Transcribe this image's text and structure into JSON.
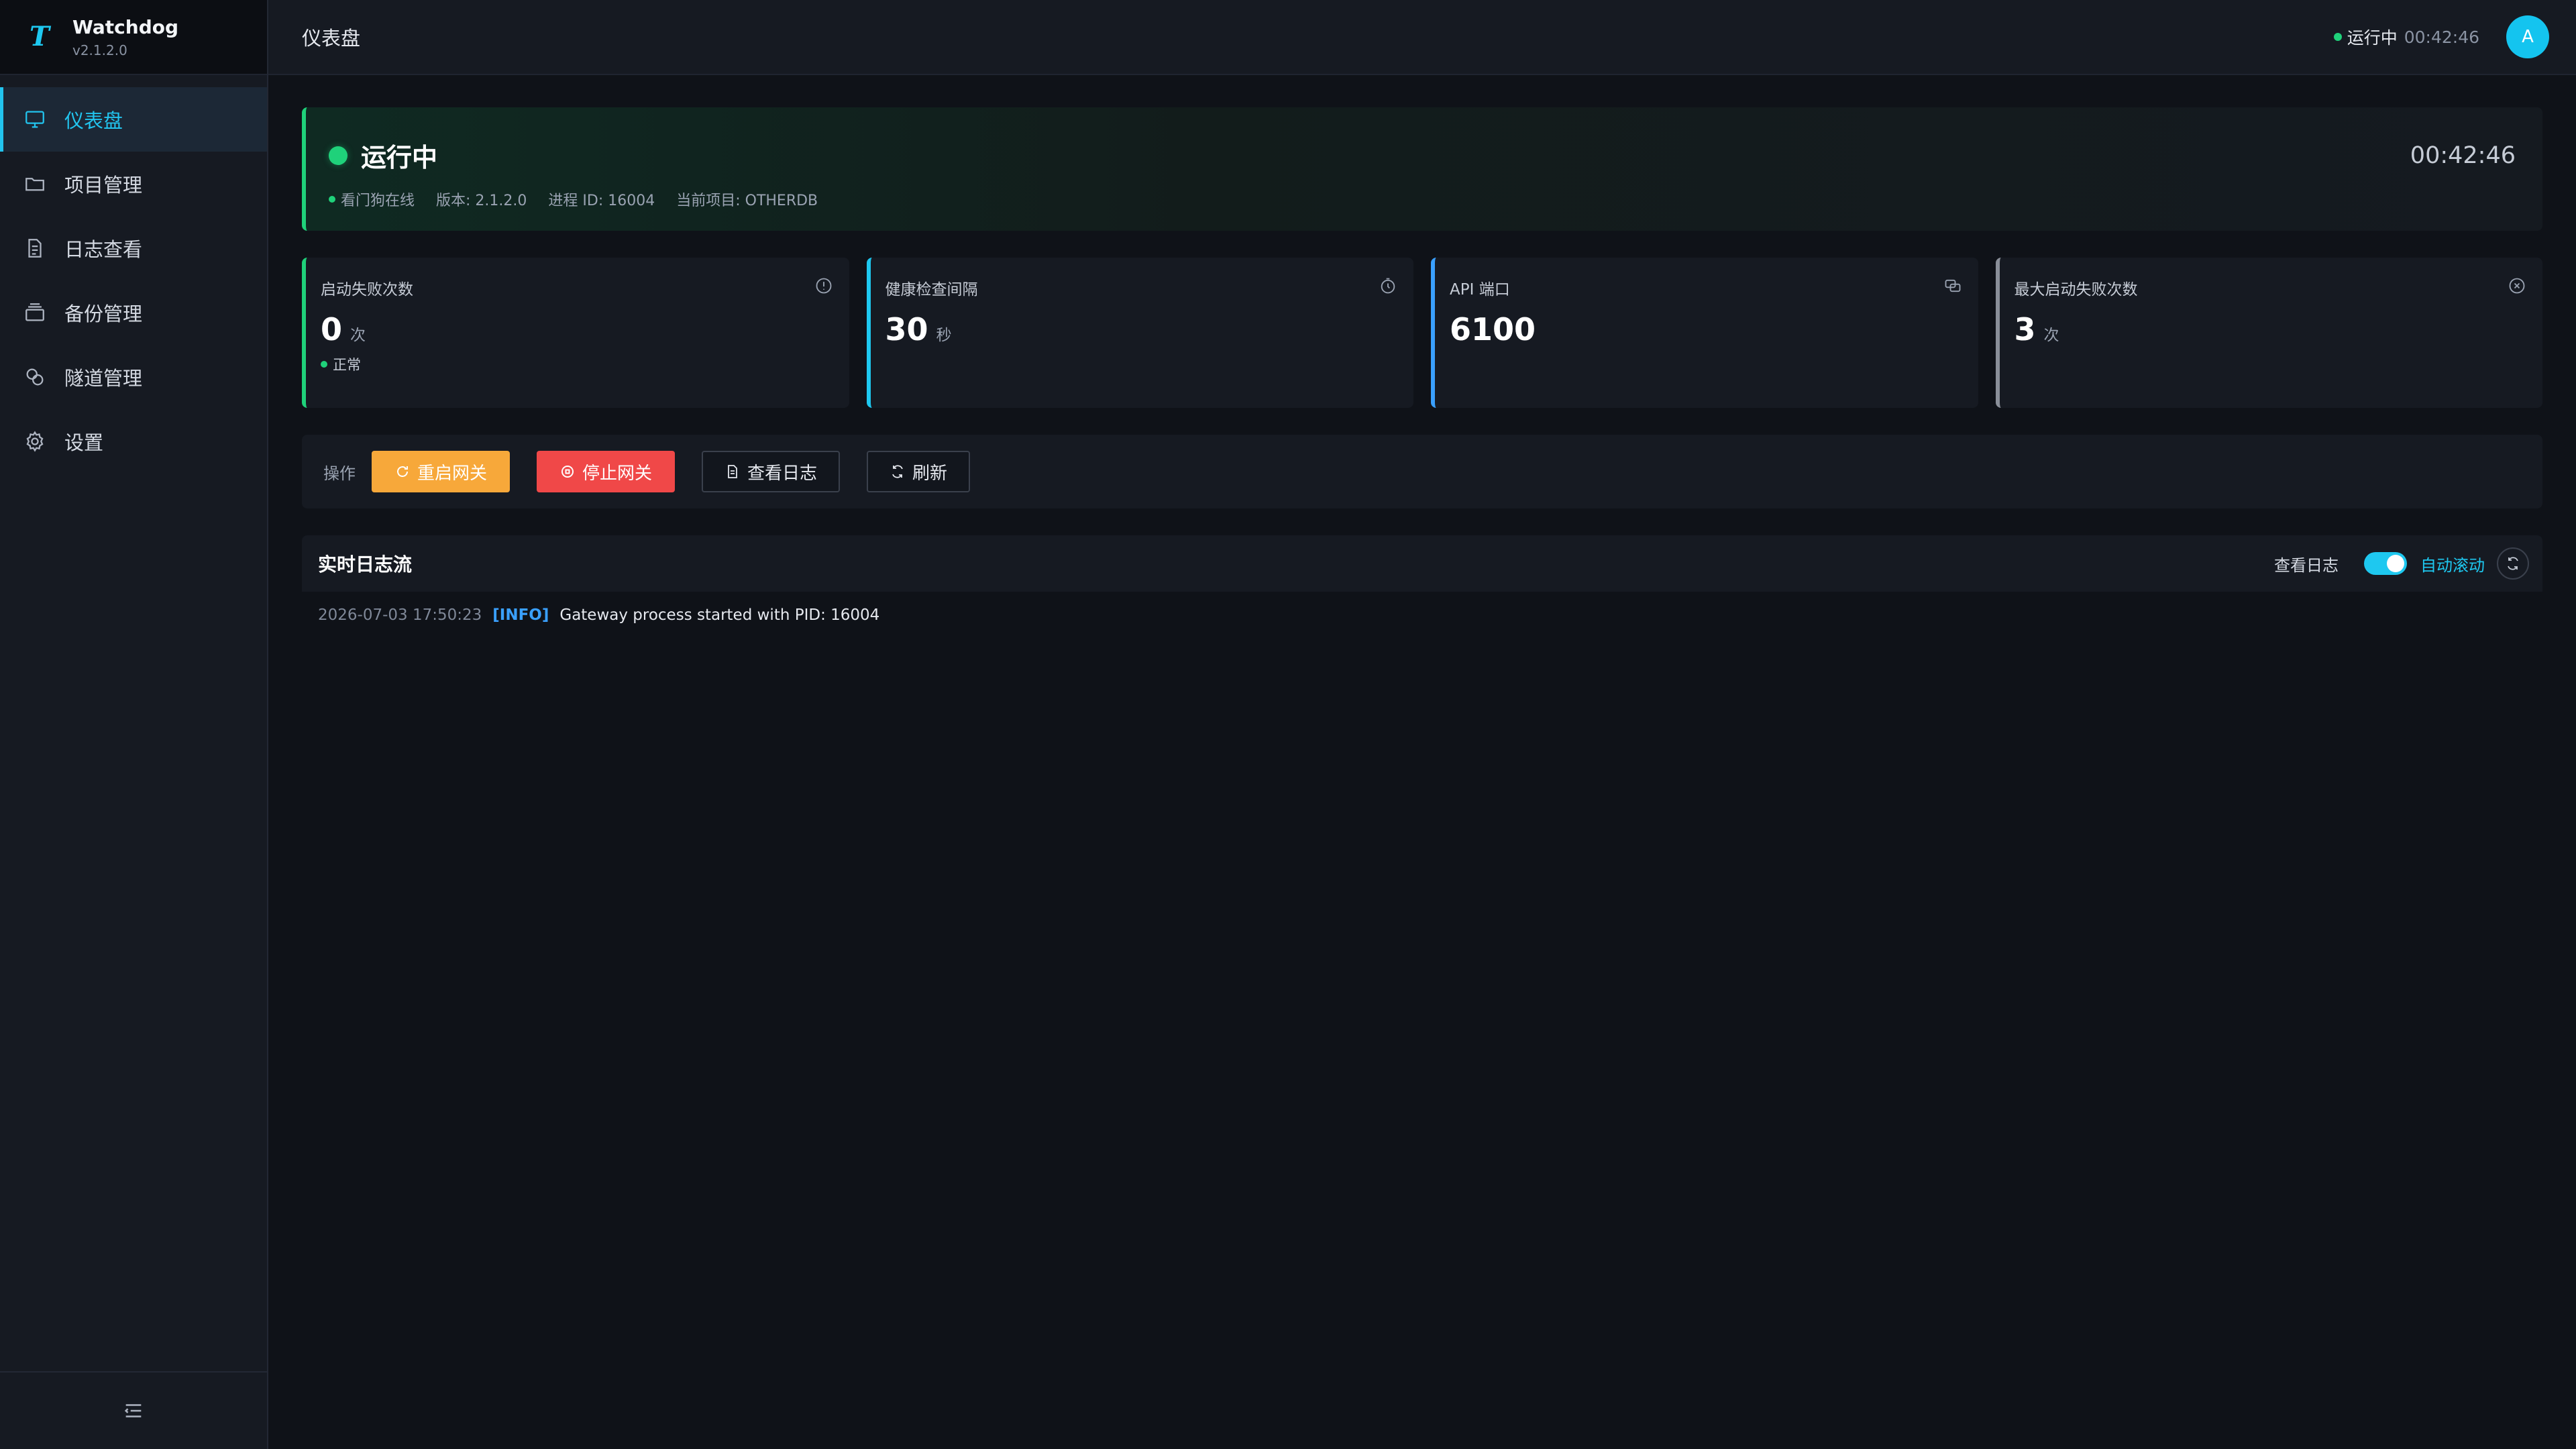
{
  "brand": {
    "name": "Watchdog",
    "version": "v2.1.2.0",
    "logo": "T"
  },
  "colors": {
    "accent": "#1ec8f0",
    "success": "#1fd17a",
    "warning": "#f7a83a",
    "danger": "#f04848",
    "info": "#3aa0ff"
  },
  "sidebar": {
    "items": [
      {
        "label": "仪表盘",
        "icon": "monitor-icon",
        "active": true
      },
      {
        "label": "项目管理",
        "icon": "folder-icon"
      },
      {
        "label": "日志查看",
        "icon": "document-icon"
      },
      {
        "label": "备份管理",
        "icon": "archive-icon"
      },
      {
        "label": "隧道管理",
        "icon": "link-icon"
      },
      {
        "label": "设置",
        "icon": "gear-icon"
      }
    ],
    "collapse_icon": "collapse-menu-icon"
  },
  "header": {
    "title": "仪表盘",
    "status": "运行中",
    "uptime": "00:42:46",
    "avatar": "A"
  },
  "status_card": {
    "title": "运行中",
    "uptime": "00:42:46",
    "watchdog": "看门狗在线",
    "version": "版本: 2.1.2.0",
    "pid": "进程 ID: 16004",
    "project": "当前项目: OTHERDB"
  },
  "stats": [
    {
      "label": "启动失败次数",
      "value": "0",
      "unit": "次",
      "note": "正常",
      "icon": "info-icon"
    },
    {
      "label": "健康检查间隔",
      "value": "30",
      "unit": "秒",
      "icon": "timer-icon"
    },
    {
      "label": "API 端口",
      "value": "6100",
      "unit": "",
      "icon": "link-icon"
    },
    {
      "label": "最大启动失败次数",
      "value": "3",
      "unit": "次",
      "icon": "close-circle-icon"
    }
  ],
  "actions": {
    "label": "操作",
    "restart": "重启网关",
    "stop": "停止网关",
    "view_logs": "查看日志",
    "refresh": "刷新"
  },
  "log": {
    "title": "实时日志流",
    "view_label": "查看日志",
    "auto_scroll": "自动滚动",
    "auto_scroll_on": true,
    "lines": [
      {
        "ts": "2026-07-03 17:50:23",
        "level": "[INFO]",
        "msg": "Gateway process started with PID: 16004"
      }
    ]
  }
}
